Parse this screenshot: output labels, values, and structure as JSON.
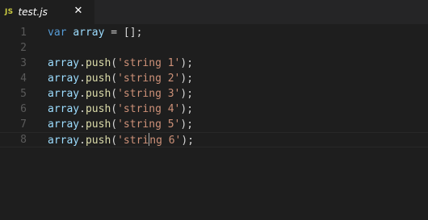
{
  "tab": {
    "icon_label": "JS",
    "title": "test.js",
    "close_glyph": "✕"
  },
  "editor": {
    "lines": [
      {
        "number": "1",
        "tokens": [
          {
            "t": "kw",
            "v": "var"
          },
          {
            "t": "op",
            "v": " "
          },
          {
            "t": "id",
            "v": "array"
          },
          {
            "t": "op",
            "v": " = [];"
          }
        ]
      },
      {
        "number": "2",
        "tokens": []
      },
      {
        "number": "3",
        "tokens": [
          {
            "t": "id",
            "v": "array"
          },
          {
            "t": "op",
            "v": "."
          },
          {
            "t": "fn",
            "v": "push"
          },
          {
            "t": "op",
            "v": "("
          },
          {
            "t": "str",
            "v": "'string 1'"
          },
          {
            "t": "op",
            "v": ");"
          }
        ]
      },
      {
        "number": "4",
        "tokens": [
          {
            "t": "id",
            "v": "array"
          },
          {
            "t": "op",
            "v": "."
          },
          {
            "t": "fn",
            "v": "push"
          },
          {
            "t": "op",
            "v": "("
          },
          {
            "t": "str",
            "v": "'string 2'"
          },
          {
            "t": "op",
            "v": ");"
          }
        ]
      },
      {
        "number": "5",
        "tokens": [
          {
            "t": "id",
            "v": "array"
          },
          {
            "t": "op",
            "v": "."
          },
          {
            "t": "fn",
            "v": "push"
          },
          {
            "t": "op",
            "v": "("
          },
          {
            "t": "str",
            "v": "'string 3'"
          },
          {
            "t": "op",
            "v": ");"
          }
        ]
      },
      {
        "number": "6",
        "tokens": [
          {
            "t": "id",
            "v": "array"
          },
          {
            "t": "op",
            "v": "."
          },
          {
            "t": "fn",
            "v": "push"
          },
          {
            "t": "op",
            "v": "("
          },
          {
            "t": "str",
            "v": "'string 4'"
          },
          {
            "t": "op",
            "v": ");"
          }
        ]
      },
      {
        "number": "7",
        "tokens": [
          {
            "t": "id",
            "v": "array"
          },
          {
            "t": "op",
            "v": "."
          },
          {
            "t": "fn",
            "v": "push"
          },
          {
            "t": "op",
            "v": "("
          },
          {
            "t": "str",
            "v": "'string 5'"
          },
          {
            "t": "op",
            "v": ");"
          }
        ]
      },
      {
        "number": "8",
        "tokens": [
          {
            "t": "id",
            "v": "array"
          },
          {
            "t": "op",
            "v": "."
          },
          {
            "t": "fn",
            "v": "push"
          },
          {
            "t": "op",
            "v": "("
          },
          {
            "t": "str",
            "v": "'stri"
          },
          {
            "t": "cursor",
            "v": ""
          },
          {
            "t": "str",
            "v": "ng 6'"
          },
          {
            "t": "op",
            "v": ");"
          }
        ]
      }
    ],
    "current_line": 8
  },
  "colors": {
    "background": "#1e1e1e",
    "keyword": "#569cd6",
    "identifier": "#9cdcfe",
    "function": "#dcdcaa",
    "string": "#ce9178",
    "punctuation": "#d4d4d4",
    "line_number": "#5a5a5a",
    "js_icon": "#cbcb41"
  }
}
